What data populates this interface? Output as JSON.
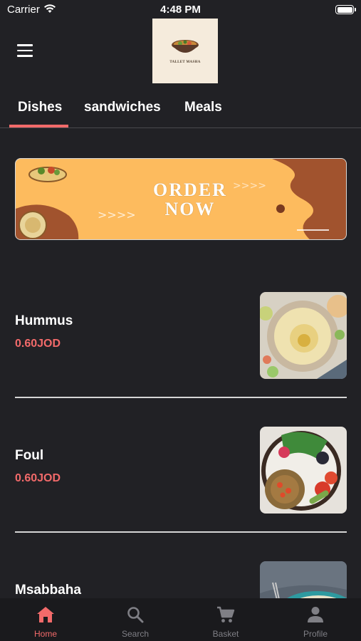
{
  "status_bar": {
    "carrier": "Carrier",
    "time": "4:48 PM"
  },
  "header": {
    "logo_text": "TALLET MASHA"
  },
  "tabs": [
    {
      "label": "Dishes",
      "active": true
    },
    {
      "label": "sandwiches",
      "active": false
    },
    {
      "label": "Meals",
      "active": false
    }
  ],
  "banner": {
    "line1": "ORDER",
    "line2": "NOW"
  },
  "dishes": [
    {
      "name": "Hummus",
      "price": "0.60JOD",
      "image": "hummus-photo"
    },
    {
      "name": "Foul",
      "price": "0.60JOD",
      "image": "foul-photo"
    },
    {
      "name": "Msabbaha",
      "price": "",
      "image": "msabbaha-photo"
    }
  ],
  "bottom_nav": [
    {
      "label": "Home",
      "icon": "home-icon",
      "active": true
    },
    {
      "label": "Search",
      "icon": "search-icon",
      "active": false
    },
    {
      "label": "Basket",
      "icon": "cart-icon",
      "active": false
    },
    {
      "label": "Profile",
      "icon": "person-icon",
      "active": false
    }
  ],
  "colors": {
    "background": "#212125",
    "accent": "#f26a6a",
    "nav_bg": "#1a1a1d",
    "banner_bg": "#fdbb5e"
  }
}
